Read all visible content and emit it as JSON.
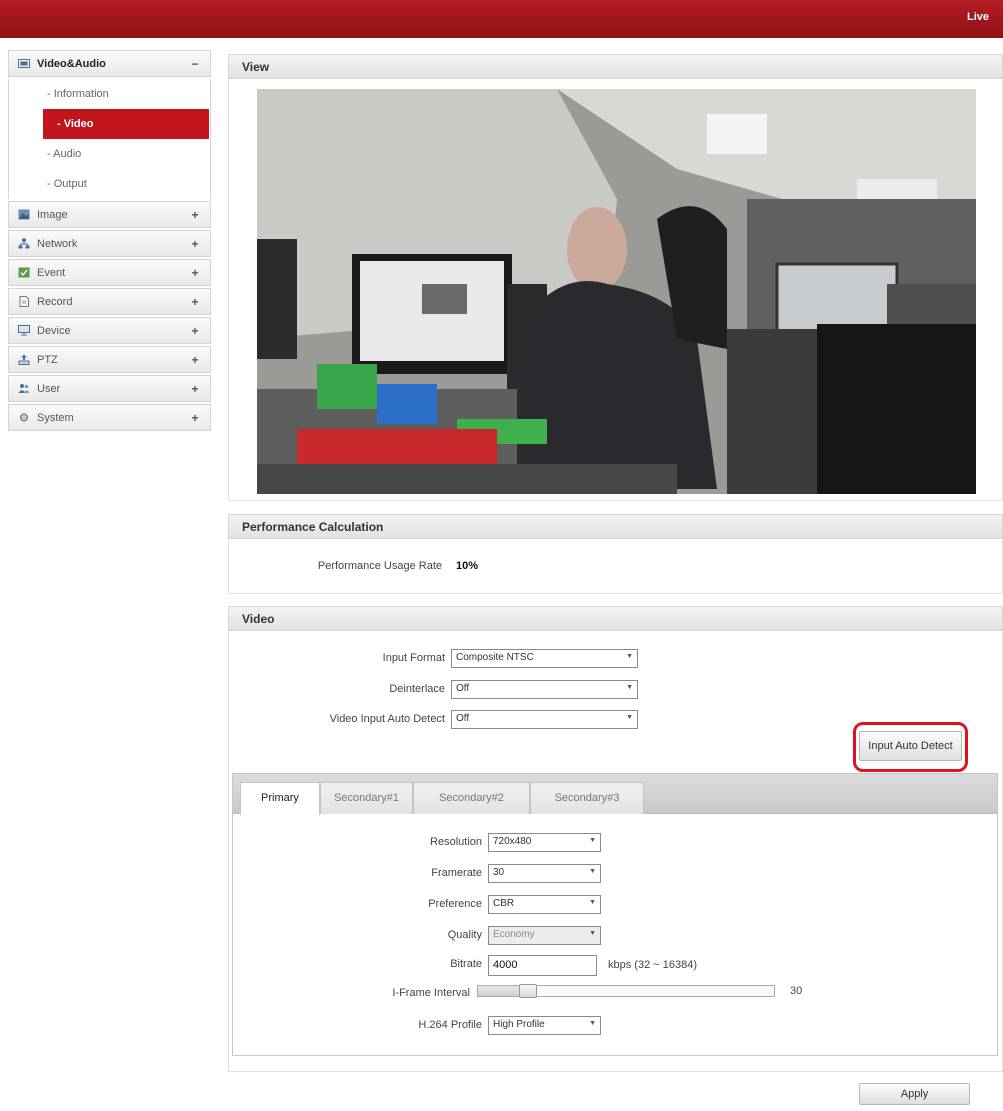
{
  "header": {
    "live_label": "Live"
  },
  "sidebar": {
    "video_audio": {
      "label": "Video&Audio",
      "toggle": "−",
      "items": [
        {
          "label": "Information"
        },
        {
          "label": "Video"
        },
        {
          "label": "Audio"
        },
        {
          "label": "Output"
        }
      ]
    },
    "menus": [
      {
        "label": "Image",
        "toggle": "+",
        "icon": "image-icon"
      },
      {
        "label": "Network",
        "toggle": "+",
        "icon": "network-icon"
      },
      {
        "label": "Event",
        "toggle": "+",
        "icon": "event-icon"
      },
      {
        "label": "Record",
        "toggle": "+",
        "icon": "record-icon"
      },
      {
        "label": "Device",
        "toggle": "+",
        "icon": "device-icon"
      },
      {
        "label": "PTZ",
        "toggle": "+",
        "icon": "ptz-icon"
      },
      {
        "label": "User",
        "toggle": "+",
        "icon": "user-icon"
      },
      {
        "label": "System",
        "toggle": "+",
        "icon": "system-icon"
      }
    ]
  },
  "view": {
    "title": "View"
  },
  "performance": {
    "title": "Performance Calculation",
    "label": "Performance Usage Rate",
    "value": "10%"
  },
  "video": {
    "title": "Video",
    "input_format": {
      "label": "Input Format",
      "value": "Composite NTSC"
    },
    "deinterlace": {
      "label": "Deinterlace",
      "value": "Off"
    },
    "auto_detect": {
      "label": "Video Input Auto Detect",
      "value": "Off"
    },
    "auto_detect_button": "Input Auto Detect"
  },
  "tabs": [
    {
      "label": "Primary"
    },
    {
      "label": "Secondary#1"
    },
    {
      "label": "Secondary#2"
    },
    {
      "label": "Secondary#3"
    }
  ],
  "primary": {
    "resolution": {
      "label": "Resolution",
      "value": "720x480"
    },
    "framerate": {
      "label": "Framerate",
      "value": "30"
    },
    "preference": {
      "label": "Preference",
      "value": "CBR"
    },
    "quality": {
      "label": "Quality",
      "value": "Economy"
    },
    "bitrate": {
      "label": "Bitrate",
      "value": "4000",
      "unit": "kbps (32 ~ 16384)"
    },
    "iframe": {
      "label": "I-Frame Interval",
      "value": "30",
      "fraction": 0.17
    },
    "h264": {
      "label": "H.264 Profile",
      "value": "High Profile"
    }
  },
  "apply_label": "Apply",
  "colors": {
    "brand": "#b41d24",
    "active": "#c1141b",
    "highlight": "#e4101f"
  }
}
